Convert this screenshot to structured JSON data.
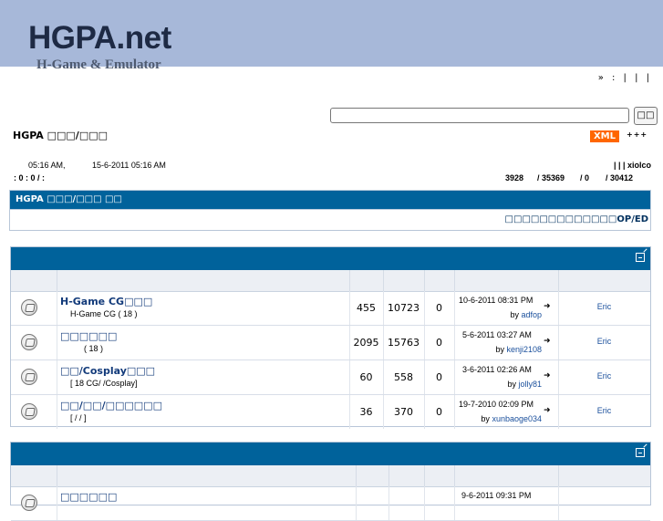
{
  "header": {
    "logo_main": "HGPA.net",
    "logo_sub": "H-Game & Emulator"
  },
  "top_links": "» : | | |",
  "search": {
    "button_label": "□□",
    "placeholder": ""
  },
  "site_title": "HGPA □□□/□□□",
  "xml_label": "XML",
  "arrows": "+++",
  "stats_left": {
    "time1": "05:16 AM,",
    "time2": "15-6-2011 05:16 AM",
    "counts": ": 0 : 0 / :"
  },
  "stats_right": {
    "line1": "| | | xiolco",
    "v1": "3928",
    "v2": "/ 35369",
    "v3": "/ 0",
    "v4": "/ 30412"
  },
  "announcement": {
    "title": "HGPA □□□/□□□ □□",
    "marquee": "□□□□□□□□□□□□□OP/ED"
  },
  "sections": [
    {
      "forums": [
        {
          "name": "H-Game CG□□□",
          "desc": "H-Game CG ( 18 )",
          "topics": "455",
          "posts": "10723",
          "zero": "0",
          "last_date": "10-6-2011 08:31 PM",
          "last_by": "by",
          "last_user": "adfop",
          "moderator": "Eric"
        },
        {
          "name": "□□□□□□",
          "desc": "( 18 )",
          "topics": "2095",
          "posts": "15763",
          "zero": "0",
          "last_date": "5-6-2011 03:27 AM",
          "last_by": "by",
          "last_user": "kenji2108",
          "moderator": "Eric"
        },
        {
          "name": "□□/Cosplay□□□",
          "desc": "[ 18 CG/ /Cosplay]",
          "topics": "60",
          "posts": "558",
          "zero": "0",
          "last_date": "3-6-2011 02:26 AM",
          "last_by": "by",
          "last_user": "jolly81",
          "moderator": "Eric"
        },
        {
          "name": "□□/□□/□□□□□□",
          "desc": "[ / / ]",
          "topics": "36",
          "posts": "370",
          "zero": "0",
          "last_date": "19-7-2010 02:09 PM",
          "last_by": "by",
          "last_user": "xunbaoge034",
          "moderator": "Eric"
        }
      ]
    },
    {
      "forums": [
        {
          "name": "□□□□□□",
          "last_date": "9-6-2011 09:31 PM"
        }
      ]
    }
  ]
}
